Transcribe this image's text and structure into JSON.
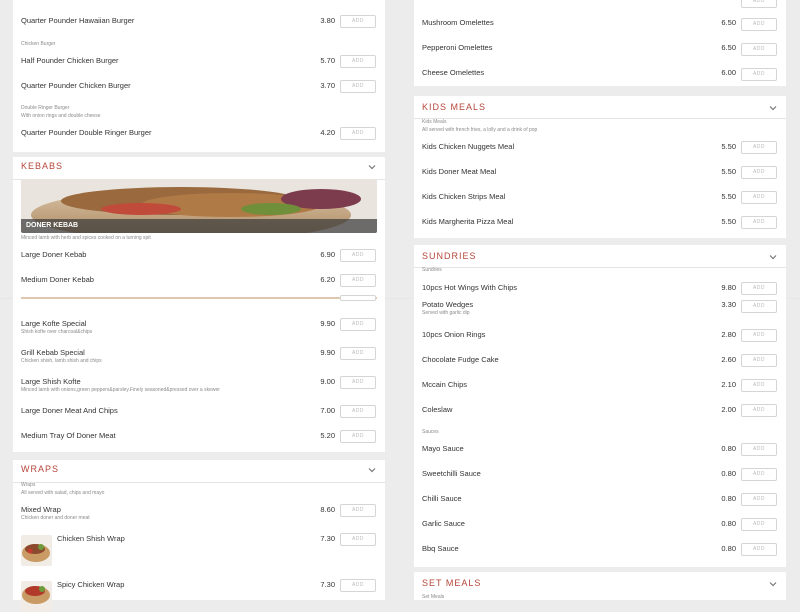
{
  "add_label": "ADD",
  "left": {
    "burgers": {
      "items": [
        {
          "name": "Quarter Pounder Hawaiian Burger",
          "price": "3.80"
        },
        {
          "name": "Half Pounder Chicken Burger",
          "price": "5.70"
        },
        {
          "name": "Quarter Pounder Chicken Burger",
          "price": "3.70"
        },
        {
          "name": "Quarter Pounder Double Ringer Burger",
          "price": "4.20"
        }
      ],
      "group_chicken": "Chicken Burger",
      "group_double_ringer": "Double Ringer Burger",
      "group_double_ringer_desc": "With onion rings and double cheese"
    },
    "kebabs": {
      "title": "KEBABS",
      "banner_label": "DONER KEBAB",
      "banner_desc": "Minced lamb with herb and spices cooked on a turning spit",
      "items": [
        {
          "name": "Large Doner Kebab",
          "price": "6.90",
          "desc": ""
        },
        {
          "name": "Medium Doner Kebab",
          "price": "6.20",
          "desc": ""
        },
        {
          "name": "Large Kofte Special",
          "price": "9.90",
          "desc": "Shish kofte over charcoal&chips"
        },
        {
          "name": "Grill Kebab Special",
          "price": "9.90",
          "desc": "Chicken shish, lamb shish and chips"
        },
        {
          "name": "Large Shish Kofte",
          "price": "9.00",
          "desc": "Minced lamb with onions,green peppers&parsley.Finely seasoned&pressed over a skewer"
        },
        {
          "name": "Large Doner Meat And Chips",
          "price": "7.00",
          "desc": ""
        },
        {
          "name": "Medium Tray Of Doner Meat",
          "price": "5.20",
          "desc": ""
        }
      ]
    },
    "wraps": {
      "title": "WRAPS",
      "group": "Wraps",
      "group_desc": "All served with salad, chips and mayo",
      "items": [
        {
          "name": "Mixed Wrap",
          "price": "8.60",
          "desc": "Chicken doner and doner meat"
        },
        {
          "name": "Chicken Shish Wrap",
          "price": "7.30",
          "desc": ""
        },
        {
          "name": "Spicy Chicken Wrap",
          "price": "7.30",
          "desc": ""
        }
      ]
    }
  },
  "right": {
    "omelettes": {
      "items": [
        {
          "name": "Mushroom Omelettes",
          "price": "6.50"
        },
        {
          "name": "Pepperoni Omelettes",
          "price": "6.50"
        },
        {
          "name": "Cheese Omelettes",
          "price": "6.00"
        }
      ]
    },
    "kids": {
      "title": "KIDS MEALS",
      "group": "Kids Meals",
      "group_desc": "All served with french fries, a lolly and a drink of pop",
      "items": [
        {
          "name": "Kids Chicken Nuggets Meal",
          "price": "5.50"
        },
        {
          "name": "Kids Doner Meat Meal",
          "price": "5.50"
        },
        {
          "name": "Kids Chicken Strips Meal",
          "price": "5.50"
        },
        {
          "name": "Kids Margherita Pizza Meal",
          "price": "5.50"
        }
      ]
    },
    "sundries": {
      "title": "SUNDRIES",
      "group": "Sundries",
      "items": [
        {
          "name": "10pcs Hot Wings With Chips",
          "price": "9.80",
          "desc": ""
        },
        {
          "name": "Potato Wedges",
          "price": "3.30",
          "desc": "Served with garlic dip"
        },
        {
          "name": "10pcs Onion Rings",
          "price": "2.80",
          "desc": ""
        },
        {
          "name": "Chocolate Fudge Cake",
          "price": "2.60",
          "desc": ""
        },
        {
          "name": "Mccain Chips",
          "price": "2.10",
          "desc": ""
        },
        {
          "name": "Coleslaw",
          "price": "2.00",
          "desc": ""
        }
      ],
      "sauces_group": "Sauces",
      "sauces": [
        {
          "name": "Mayo Sauce",
          "price": "0.80"
        },
        {
          "name": "Sweetchilli Sauce",
          "price": "0.80"
        },
        {
          "name": "Chilli Sauce",
          "price": "0.80"
        },
        {
          "name": "Garlic Sauce",
          "price": "0.80"
        },
        {
          "name": "Bbq Sauce",
          "price": "0.80"
        }
      ]
    },
    "set_meals": {
      "title": "SET MEALS",
      "group": "Set Meals"
    }
  },
  "icons": {
    "chevron": "chevron-down-icon",
    "doner_image": "doner-kebab-image",
    "wrap_image": "wrap-image"
  },
  "colors": {
    "accent": "#b5463a",
    "background": "#ececec",
    "card": "#ffffff"
  }
}
